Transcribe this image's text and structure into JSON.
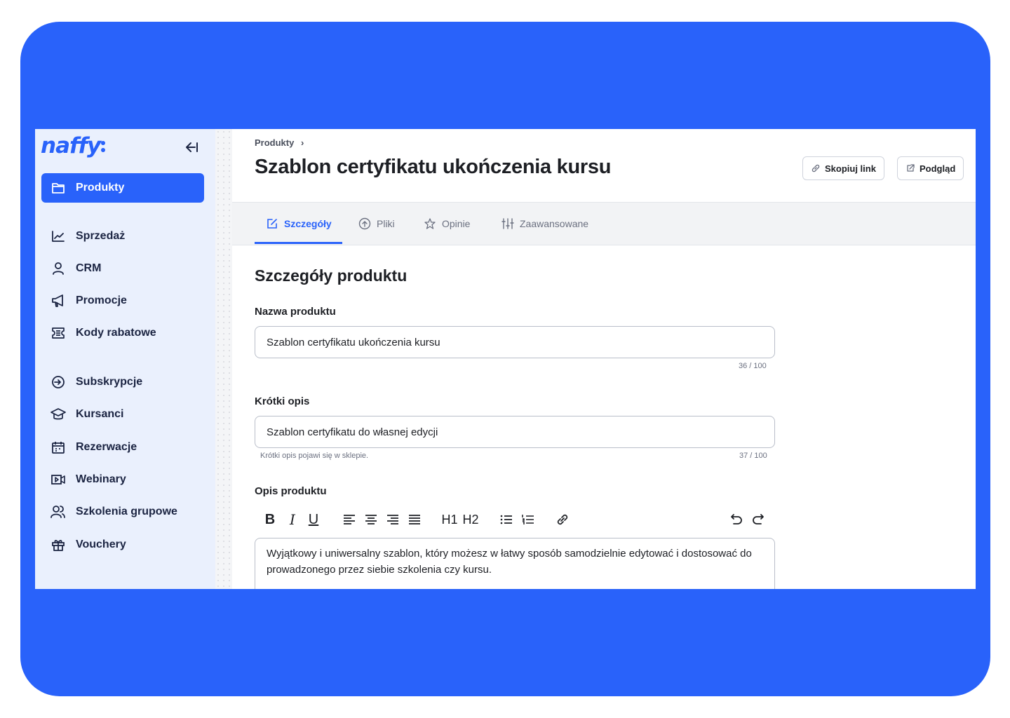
{
  "brand": {
    "name": "naffy",
    "color": "#2962fa"
  },
  "sidebar": {
    "collapse_icon": "collapse-left-icon",
    "items": [
      {
        "label": "Produkty",
        "icon": "folder-icon",
        "active": true
      },
      {
        "label": "Sprzedaż",
        "icon": "chart-line-icon"
      },
      {
        "label": "CRM",
        "icon": "user-icon"
      },
      {
        "label": "Promocje",
        "icon": "megaphone-icon"
      },
      {
        "label": "Kody rabatowe",
        "icon": "coupon-icon"
      },
      {
        "label": "Subskrypcje",
        "icon": "login-circle-icon"
      },
      {
        "label": "Kursanci",
        "icon": "graduation-cap-icon"
      },
      {
        "label": "Rezerwacje",
        "icon": "calendar-icon"
      },
      {
        "label": "Webinary",
        "icon": "video-icon"
      },
      {
        "label": "Szkolenia grupowe",
        "icon": "users-icon"
      },
      {
        "label": "Vouchery",
        "icon": "gift-icon"
      }
    ]
  },
  "header": {
    "breadcrumb": "Produkty",
    "breadcrumb_sep": "›",
    "title": "Szablon certyfikatu ukończenia kursu",
    "copy_link_label": "Skopiuj link",
    "preview_label": "Podgląd"
  },
  "tabs": [
    {
      "label": "Szczegóły",
      "icon": "edit-icon",
      "active": true
    },
    {
      "label": "Pliki",
      "icon": "upload-cloud-icon"
    },
    {
      "label": "Opinie",
      "icon": "star-icon"
    },
    {
      "label": "Zaawansowane",
      "icon": "sliders-icon"
    }
  ],
  "form": {
    "section_title": "Szczegóły produktu",
    "name": {
      "label": "Nazwa produktu",
      "value": "Szablon certyfikatu ukończenia kursu",
      "counter": "36 / 100"
    },
    "short_desc": {
      "label": "Krótki opis",
      "value": "Szablon certyfikatu do własnej edycji",
      "hint": "Krótki opis pojawi się w sklepie.",
      "counter": "37 / 100"
    },
    "description": {
      "label": "Opis produktu",
      "toolbar": {
        "bold": "B",
        "italic": "I",
        "underline": "U",
        "h1": "H1",
        "h2": "H2"
      },
      "value": "Wyjątkowy i uniwersalny szablon, który możesz w łatwy sposób samodzielnie edytować i dostosować do prowadzonego przez siebie szkolenia czy kursu."
    }
  }
}
